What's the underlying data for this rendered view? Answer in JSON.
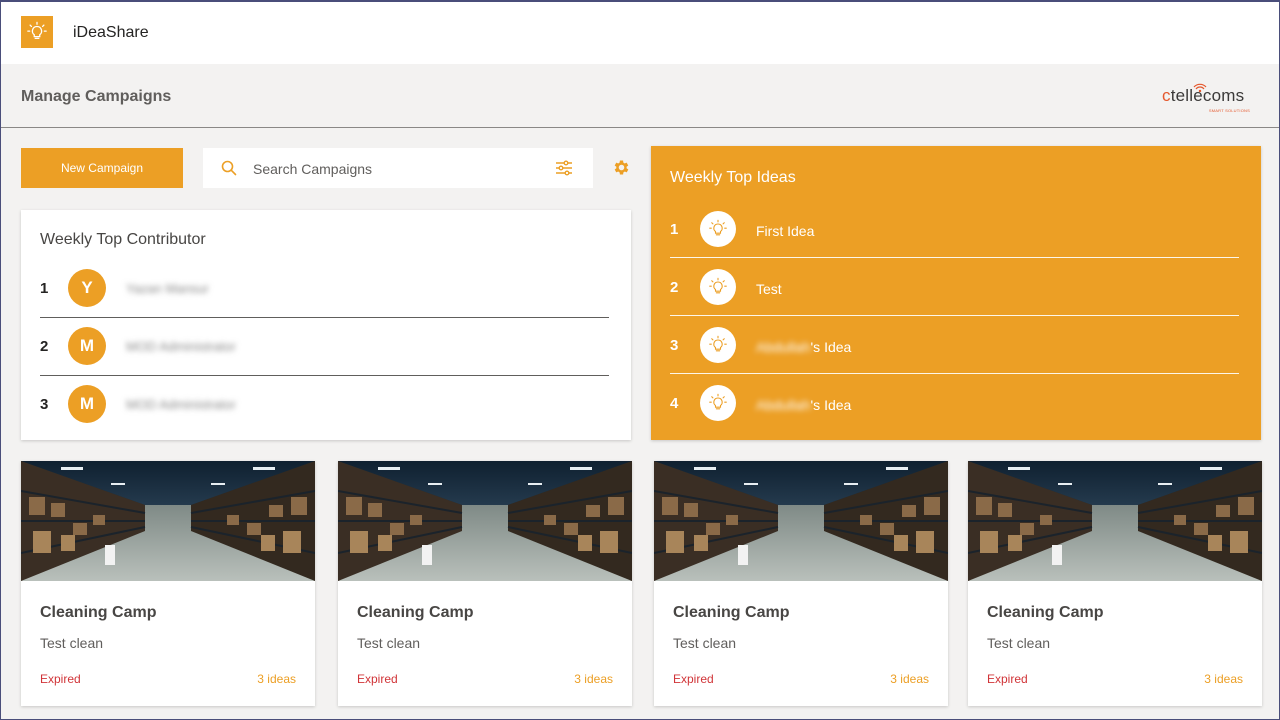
{
  "app": {
    "name": "iDeaShare"
  },
  "page": {
    "title": "Manage Campaigns"
  },
  "brand": {
    "logo_text_c": "c",
    "logo_text_rest": "tellecoms",
    "logo_sub": "SMART SOLUTIONS"
  },
  "toolbar": {
    "new_campaign_label": "New Campaign",
    "search_placeholder": "Search Campaigns"
  },
  "contributors": {
    "title": "Weekly Top Contributor",
    "items": [
      {
        "rank": "1",
        "initial": "Y",
        "name": "Yazan Mansur"
      },
      {
        "rank": "2",
        "initial": "M",
        "name": "MOD Administrator"
      },
      {
        "rank": "3",
        "initial": "M",
        "name": "MOD Administrator"
      }
    ]
  },
  "top_ideas": {
    "title": "Weekly Top Ideas",
    "items": [
      {
        "rank": "1",
        "name_blur": "",
        "name": "First Idea"
      },
      {
        "rank": "2",
        "name_blur": "",
        "name": "Test"
      },
      {
        "rank": "3",
        "name_blur": "Abdullah",
        "name": "'s Idea"
      },
      {
        "rank": "4",
        "name_blur": "Abdullah",
        "name": "'s Idea"
      }
    ]
  },
  "campaigns": [
    {
      "title": "Cleaning Camp",
      "description": "Test clean",
      "status": "Expired",
      "ideas": "3 ideas"
    },
    {
      "title": "Cleaning Camp",
      "description": "Test clean",
      "status": "Expired",
      "ideas": "3 ideas"
    },
    {
      "title": "Cleaning Camp",
      "description": "Test clean",
      "status": "Expired",
      "ideas": "3 ideas"
    },
    {
      "title": "Cleaning Camp",
      "description": "Test clean",
      "status": "Expired",
      "ideas": "3 ideas"
    }
  ],
  "colors": {
    "accent": "#ec9f25",
    "expired": "#d13438"
  },
  "icons": {
    "app": "lightbulb-icon",
    "search": "search-icon",
    "filter": "filter-icon",
    "settings": "gear-icon",
    "idea": "lightbulb-icon"
  }
}
